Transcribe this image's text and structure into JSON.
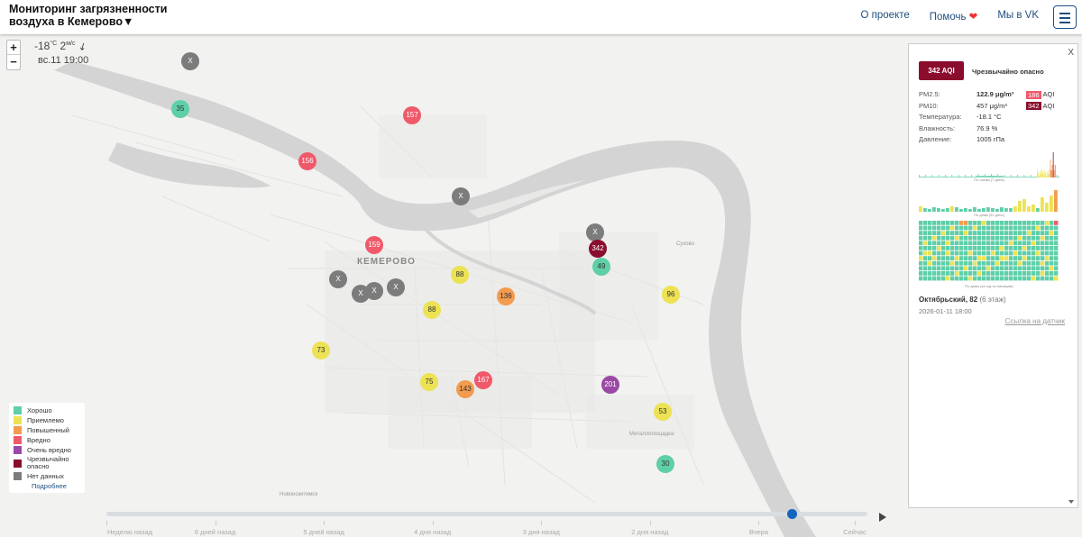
{
  "header": {
    "title_line1": "Мониторинг загрязненности",
    "title_line2": "воздуха в Кемерово▼",
    "nav_about": "О проекте",
    "nav_help": "Помочь",
    "nav_vk": "Мы в VK"
  },
  "weather": {
    "temp": "-18",
    "temp_unit": "°C",
    "wind": "2",
    "wind_unit": "м/с",
    "datetime": "вс.11 19:00"
  },
  "map": {
    "city_label": "КЕМЕРОВО",
    "district_labels": [
      "Сухово",
      "Металлплощадка",
      "Новоискитимск"
    ],
    "markers": [
      {
        "label": "X",
        "color": "#7c7c7c"
      },
      {
        "label": "35",
        "color": "#5fcfa8"
      },
      {
        "label": "157",
        "color": "#f0596a"
      },
      {
        "label": "156",
        "color": "#f0596a"
      },
      {
        "label": "X",
        "color": "#7c7c7c"
      },
      {
        "label": "159",
        "color": "#f0596a"
      },
      {
        "label": "X",
        "color": "#7c7c7c"
      },
      {
        "label": "342",
        "color": "#8b0d2e"
      },
      {
        "label": "49",
        "color": "#5fcfa8"
      },
      {
        "label": "88",
        "color": "#ece254"
      },
      {
        "label": "X",
        "color": "#7c7c7c"
      },
      {
        "label": "X",
        "color": "#7c7c7c"
      },
      {
        "label": "X",
        "color": "#7c7c7c"
      },
      {
        "label": "X",
        "color": "#7c7c7c"
      },
      {
        "label": "136",
        "color": "#f39b4e"
      },
      {
        "label": "96",
        "color": "#ece254"
      },
      {
        "label": "88",
        "color": "#ece254"
      },
      {
        "label": "73",
        "color": "#ece254"
      },
      {
        "label": "75",
        "color": "#ece254"
      },
      {
        "label": "143",
        "color": "#f39b4e"
      },
      {
        "label": "167",
        "color": "#f0596a"
      },
      {
        "label": "201",
        "color": "#9a4aa6"
      },
      {
        "label": "53",
        "color": "#ece254"
      },
      {
        "label": "30",
        "color": "#5fcfa8"
      }
    ]
  },
  "legend": {
    "items": [
      {
        "label": "Хорошо",
        "color": "#5fcfa8"
      },
      {
        "label": "Приемлемо",
        "color": "#ece254"
      },
      {
        "label": "Повышенный",
        "color": "#f39b4e"
      },
      {
        "label": "Вредно",
        "color": "#f0596a"
      },
      {
        "label": "Очень вредно",
        "color": "#9a4aa6"
      },
      {
        "label": "Чрезвычайно опасно",
        "color": "#8b0d2e"
      },
      {
        "label": "Нет данных",
        "color": "#7c7c7c"
      }
    ],
    "more": "Подробнее"
  },
  "timeline": {
    "labels": [
      "Неделю назад",
      "6 дней назад",
      "5 дней назад",
      "4 дня назад",
      "3 дня назад",
      "2 дня назад",
      "Вчера",
      "Сейчас"
    ],
    "position": 0.9
  },
  "panel": {
    "close": "X",
    "aqi_value": "342 AQI",
    "aqi_status": "Чрезвычайно опасно",
    "pm25_label": "PM2.5:",
    "pm25_value": "122.9 μg/m³",
    "pm25_aqi": "186",
    "pm10_label": "PM10:",
    "pm10_value": "457 μg/m³",
    "pm10_aqi": "342",
    "aqi_unit": "AQI",
    "temp_label": "Температура:",
    "temp_value": "-18.1 °C",
    "humidity_label": "Влажность:",
    "humidity_value": "76.9 %",
    "pressure_label": "Давление:",
    "pressure_value": "1005 гПа",
    "chart_hours_caption": "По часам (7 дней)",
    "chart_days_caption": "По дням (31 день)",
    "heatmap_caption": "По дням (за год по месяцам)",
    "location": "Октябрьский, 82",
    "location_floor": "(6 этаж)",
    "date": "2026-01-11 18:00",
    "sensor_link": "Ссылка на датчик"
  }
}
